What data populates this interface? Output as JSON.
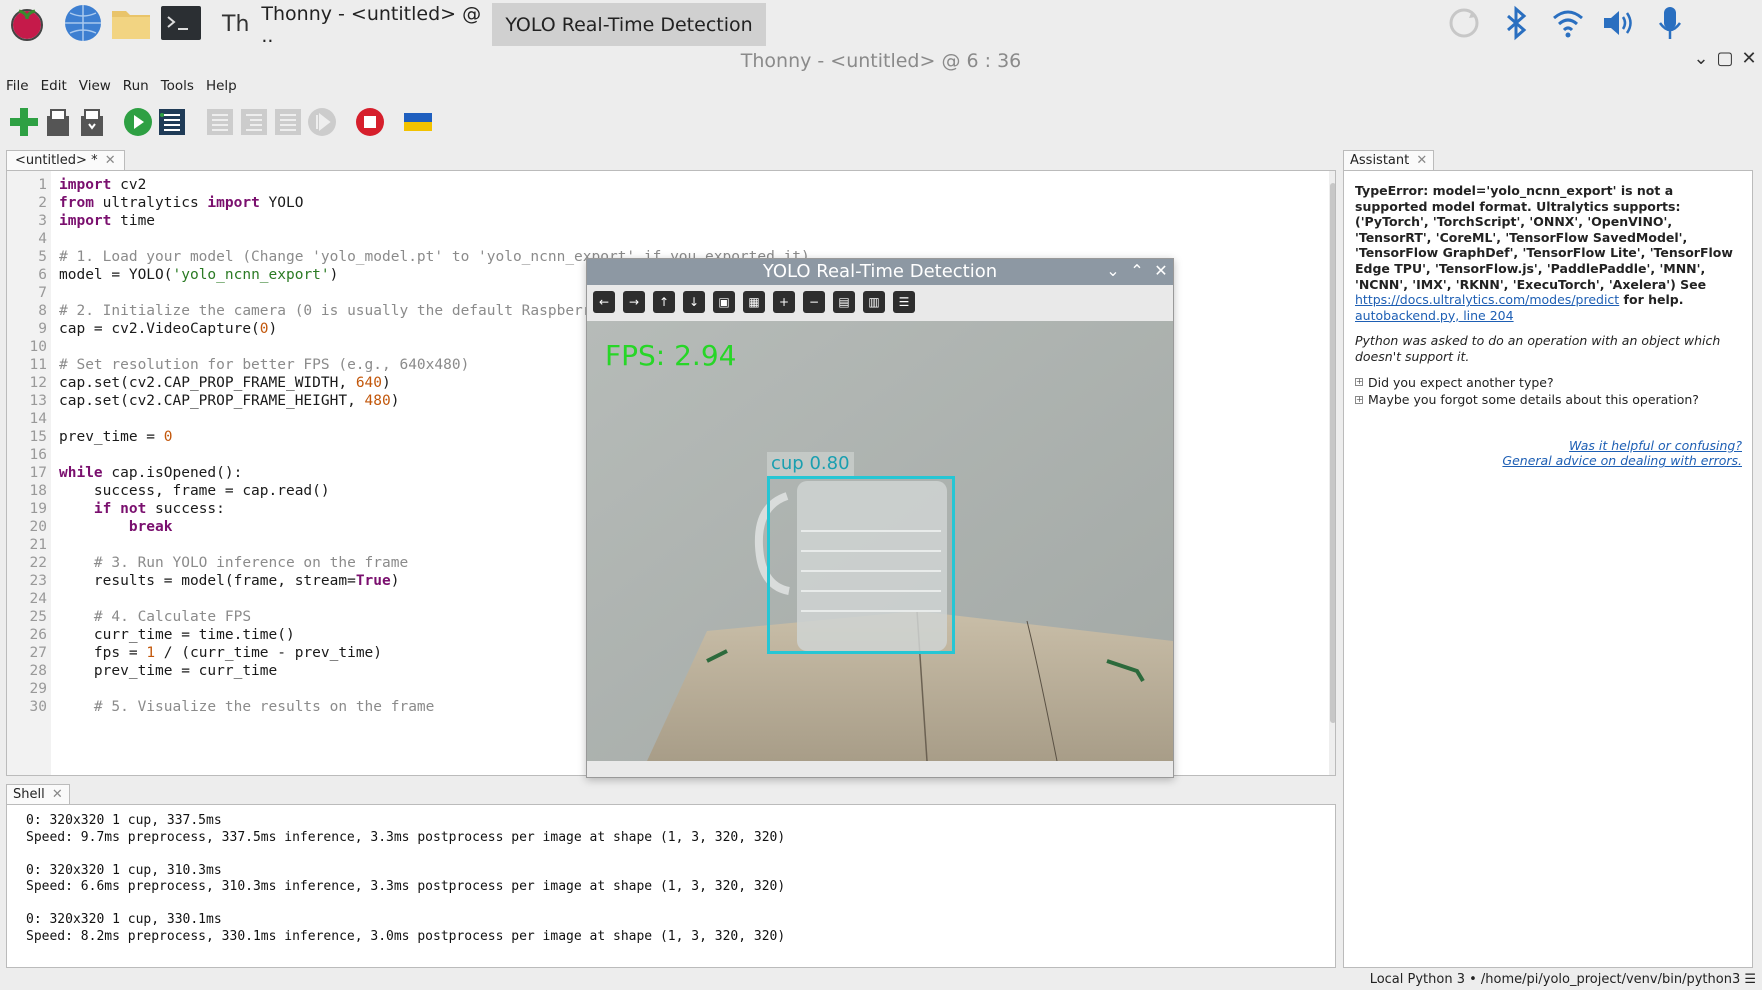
{
  "taskbar": {
    "tasks": [
      {
        "label": "Thonny  -  <untitled>  @  ..",
        "active": false
      },
      {
        "label": "YOLO Real-Time Detection",
        "active": true
      }
    ]
  },
  "window": {
    "title": "Thonny  -  <untitled>  @  6 : 36"
  },
  "menu": [
    "File",
    "Edit",
    "View",
    "Run",
    "Tools",
    "Help"
  ],
  "editor": {
    "tab_label": "<untitled> *",
    "lines": [
      {
        "n": "1",
        "html": "<span class='kw'>import</span> cv2"
      },
      {
        "n": "2",
        "html": "<span class='kw'>from</span> ultralytics <span class='kw'>import</span> YOLO"
      },
      {
        "n": "3",
        "html": "<span class='kw'>import</span> time"
      },
      {
        "n": "4",
        "html": ""
      },
      {
        "n": "5",
        "html": "<span class='cm'># 1. Load your model (Change 'yolo_model.pt' to 'yolo_ncnn_export' if you exported it)</span>"
      },
      {
        "n": "6",
        "html": "model = YOLO(<span class='st'>'yolo_ncnn_export'</span>)"
      },
      {
        "n": "7",
        "html": ""
      },
      {
        "n": "8",
        "html": "<span class='cm'># 2. Initialize the camera (0 is usually the default Raspberry Pi camera)</span>"
      },
      {
        "n": "9",
        "html": "cap = cv2.VideoCapture(<span class='nm'>0</span>)"
      },
      {
        "n": "10",
        "html": ""
      },
      {
        "n": "11",
        "html": "<span class='cm'># Set resolution for better FPS (e.g., 640x480)</span>"
      },
      {
        "n": "12",
        "html": "cap.set(cv2.CAP_PROP_FRAME_WIDTH, <span class='nm'>640</span>)"
      },
      {
        "n": "13",
        "html": "cap.set(cv2.CAP_PROP_FRAME_HEIGHT, <span class='nm'>480</span>)"
      },
      {
        "n": "14",
        "html": ""
      },
      {
        "n": "15",
        "html": "prev_time = <span class='nm'>0</span>"
      },
      {
        "n": "16",
        "html": ""
      },
      {
        "n": "17",
        "html": "<span class='kw'>while</span> cap.isOpened():"
      },
      {
        "n": "18",
        "html": "    success, frame = cap.read()"
      },
      {
        "n": "19",
        "html": "    <span class='kw'>if not</span> success:"
      },
      {
        "n": "20",
        "html": "        <span class='kw'>break</span>"
      },
      {
        "n": "21",
        "html": ""
      },
      {
        "n": "22",
        "html": "    <span class='cm'># 3. Run YOLO inference on the frame</span>"
      },
      {
        "n": "23",
        "html": "    results = model(frame, stream=<span class='kw'>True</span>)"
      },
      {
        "n": "24",
        "html": ""
      },
      {
        "n": "25",
        "html": "    <span class='cm'># 4. Calculate FPS</span>"
      },
      {
        "n": "26",
        "html": "    curr_time = time.time()"
      },
      {
        "n": "27",
        "html": "    fps = <span class='nm'>1</span> / (curr_time - prev_time)"
      },
      {
        "n": "28",
        "html": "    prev_time = curr_time"
      },
      {
        "n": "29",
        "html": ""
      },
      {
        "n": "30",
        "html": "    <span class='cm'># 5. Visualize the results on the frame</span>"
      }
    ]
  },
  "shell": {
    "tab_label": "Shell",
    "lines": [
      "0: 320x320 1 cup, 337.5ms",
      "Speed: 9.7ms preprocess, 337.5ms inference, 3.3ms postprocess per image at shape (1, 3, 320, 320)",
      "",
      "0: 320x320 1 cup, 310.3ms",
      "Speed: 6.6ms preprocess, 310.3ms inference, 3.3ms postprocess per image at shape (1, 3, 320, 320)",
      "",
      "0: 320x320 1 cup, 330.1ms",
      "Speed: 8.2ms preprocess, 330.1ms inference, 3.0ms postprocess per image at shape (1, 3, 320, 320)"
    ]
  },
  "assistant": {
    "tab_label": "Assistant",
    "error": "TypeError: model='yolo_ncnn_export' is not a supported model format. Ultralytics supports: ('PyTorch', 'TorchScript', 'ONNX', 'OpenVINO', 'TensorRT', 'CoreML', 'TensorFlow SavedModel', 'TensorFlow GraphDef', 'TensorFlow Lite', 'TensorFlow Edge TPU', 'TensorFlow.js', 'PaddlePaddle', 'MNN', 'NCNN', 'IMX', 'RKNN', 'ExecuTorch', 'Axelera') See",
    "link1": "https://docs.ultralytics.com/modes/predict",
    "for_help": " for help.",
    "link2": "autobackend.py, line 204",
    "explanation": "Python was asked to do an operation with an object which doesn't support it.",
    "hints": [
      "Did you expect another type?",
      "Maybe you forgot some details about this operation?"
    ],
    "feedback": "Was it helpful or confusing?",
    "advice": "General advice on dealing with errors."
  },
  "status": {
    "interpreter": "Local Python 3  •  /home/pi/yolo_project/venv/bin/python3  ☰"
  },
  "yolo": {
    "title": "YOLO Real-Time Detection",
    "fps_text": "FPS: 2.94",
    "detection_label": "cup  0.80"
  }
}
